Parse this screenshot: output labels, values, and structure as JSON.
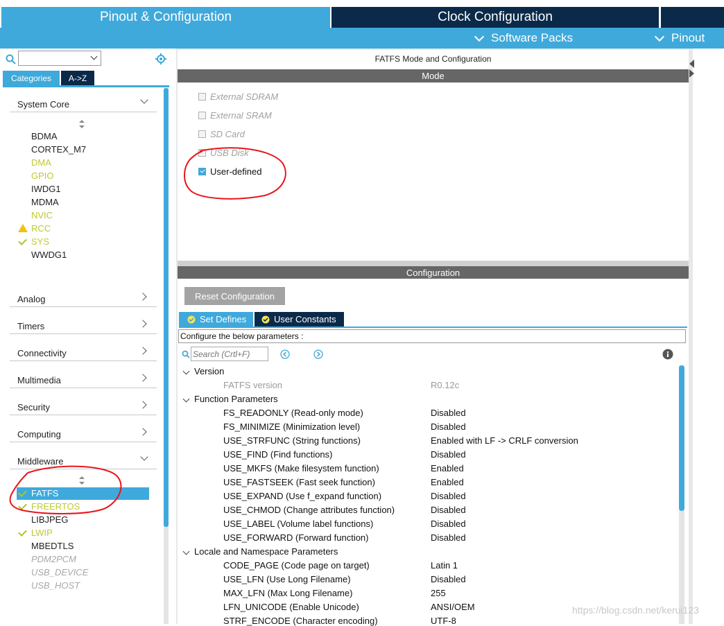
{
  "tabs": {
    "pinout_config": "Pinout & Configuration",
    "clock_config": "Clock Configuration"
  },
  "subbar": {
    "software_packs": "Software Packs",
    "pinout": "Pinout"
  },
  "left": {
    "search_value": "",
    "tab_categories": "Categories",
    "tab_az": "A->Z",
    "system_core": "System Core",
    "system_core_items": [
      {
        "label": "BDMA",
        "status": "none"
      },
      {
        "label": "CORTEX_M7",
        "status": "none"
      },
      {
        "label": "DMA",
        "status": "enabled-text"
      },
      {
        "label": "GPIO",
        "status": "enabled-text"
      },
      {
        "label": "IWDG1",
        "status": "none"
      },
      {
        "label": "MDMA",
        "status": "none"
      },
      {
        "label": "NVIC",
        "status": "enabled-text"
      },
      {
        "label": "RCC",
        "status": "warning"
      },
      {
        "label": "SYS",
        "status": "checked"
      },
      {
        "label": "WWDG1",
        "status": "none"
      }
    ],
    "categories": [
      "Analog",
      "Timers",
      "Connectivity",
      "Multimedia",
      "Security",
      "Computing",
      "Middleware"
    ],
    "middleware_items": [
      {
        "label": "FATFS",
        "status": "checked-selected"
      },
      {
        "label": "FREERTOS",
        "status": "checked"
      },
      {
        "label": "LIBJPEG",
        "status": "none"
      },
      {
        "label": "LWIP",
        "status": "checked"
      },
      {
        "label": "MBEDTLS",
        "status": "none"
      },
      {
        "label": "PDM2PCM",
        "status": "disabled"
      },
      {
        "label": "USB_DEVICE",
        "status": "disabled"
      },
      {
        "label": "USB_HOST",
        "status": "disabled"
      }
    ]
  },
  "right": {
    "title": "FATFS Mode and Configuration",
    "mode_bar": "Mode",
    "mode_options": [
      {
        "label": "External SDRAM",
        "checked": false,
        "disabled": true
      },
      {
        "label": "External SRAM",
        "checked": false,
        "disabled": true
      },
      {
        "label": "SD Card",
        "checked": false,
        "disabled": true
      },
      {
        "label": "USB Disk",
        "checked": false,
        "disabled": true
      },
      {
        "label": "User-defined",
        "checked": true,
        "disabled": false
      }
    ],
    "config_bar": "Configuration",
    "reset_button": "Reset Configuration",
    "tab_set_defines": "Set Defines",
    "tab_user_constants": "User Constants",
    "configure_text": "Configure the below parameters :",
    "search_placeholder": "Search (Crtl+F)",
    "groups": [
      {
        "name": "Version",
        "params": [
          {
            "name": "FATFS version",
            "value": "R0.12c",
            "dim": true
          }
        ]
      },
      {
        "name": "Function Parameters",
        "params": [
          {
            "name": "FS_READONLY (Read-only mode)",
            "value": "Disabled"
          },
          {
            "name": "FS_MINIMIZE (Minimization level)",
            "value": "Disabled"
          },
          {
            "name": "USE_STRFUNC (String functions)",
            "value": "Enabled with LF -> CRLF conversion"
          },
          {
            "name": "USE_FIND (Find functions)",
            "value": "Disabled"
          },
          {
            "name": "USE_MKFS (Make filesystem function)",
            "value": "Enabled"
          },
          {
            "name": "USE_FASTSEEK (Fast seek function)",
            "value": "Enabled"
          },
          {
            "name": "USE_EXPAND (Use f_expand function)",
            "value": "Disabled"
          },
          {
            "name": "USE_CHMOD (Change attributes function)",
            "value": "Disabled"
          },
          {
            "name": "USE_LABEL (Volume label functions)",
            "value": "Disabled"
          },
          {
            "name": "USE_FORWARD (Forward function)",
            "value": "Disabled"
          }
        ]
      },
      {
        "name": "Locale and Namespace Parameters",
        "params": [
          {
            "name": "CODE_PAGE (Code page on target)",
            "value": "Latin 1"
          },
          {
            "name": "USE_LFN (Use Long Filename)",
            "value": "Disabled"
          },
          {
            "name": "MAX_LFN (Max Long Filename)",
            "value": "255"
          },
          {
            "name": "LFN_UNICODE (Enable Unicode)",
            "value": "ANSI/OEM"
          },
          {
            "name": "STRF_ENCODE (Character encoding)",
            "value": "UTF-8"
          }
        ]
      }
    ]
  },
  "watermark": "https://blog.csdn.net/kerui123",
  "colors": {
    "accent": "#3fa9db",
    "navy": "#0b2a4a",
    "green": "#a6c82d",
    "annotation": "#e8141b"
  }
}
